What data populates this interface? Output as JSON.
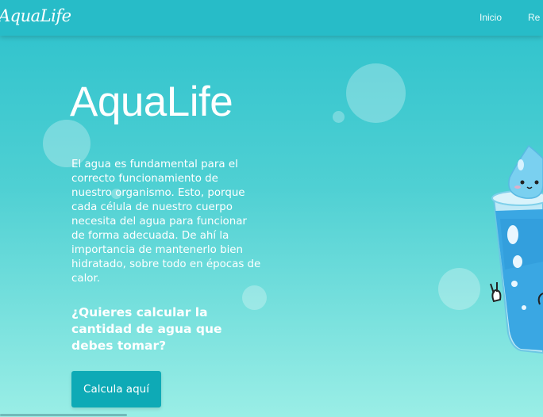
{
  "navbar": {
    "brand": "AquaLife",
    "links": [
      "Inicio",
      "Re"
    ]
  },
  "hero": {
    "title": "AquaLife",
    "description": "El agua es fundamental para el correcto funcionamiento de nuestro organismo. Esto, porque cada célula de nuestro cuerpo necesita del agua para funcionar de forma adecuada. De ahí la importancia de mantenerlo bien hidratado, sobre todo en épocas de calor.",
    "question": "¿Quieres calcular la cantidad de agua que debes tomar?",
    "cta_label": "Calcula aquí"
  },
  "colors": {
    "navbar": "#27bcc8",
    "button": "#0eaab6",
    "gradient_top": "#2cc1cc",
    "gradient_bottom": "#9aeee6"
  },
  "icons": [
    "water-glass-mascot-icon"
  ]
}
